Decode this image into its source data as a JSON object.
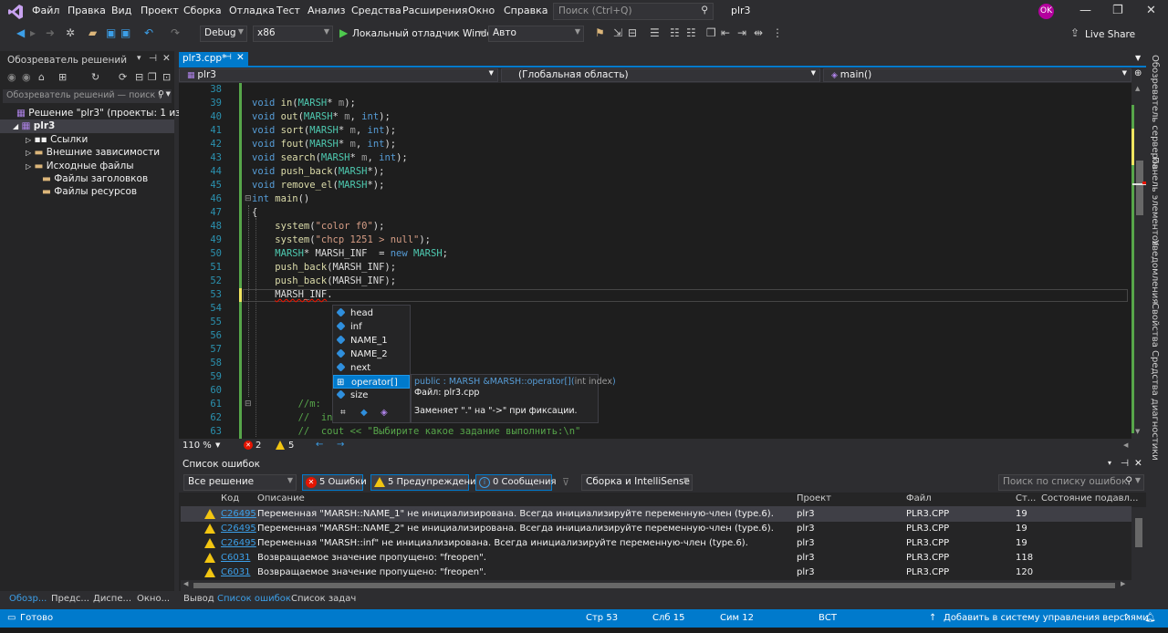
{
  "menu": {
    "items": [
      "Файл",
      "Правка",
      "Вид",
      "Проект",
      "Сборка",
      "Отладка",
      "Тест",
      "Анализ",
      "Средства",
      "Расширения",
      "Окно",
      "Справка"
    ],
    "search_placeholder": "Поиск (Ctrl+Q)",
    "solution_name": "plr3",
    "user_initials": "OK"
  },
  "toolbar": {
    "config": "Debug",
    "platform": "x86",
    "run_label": "Локальный отладчик Windows",
    "run_mode": "Авто",
    "live_share": "Live Share"
  },
  "solution_explorer": {
    "title": "Обозреватель решений",
    "search_placeholder": "Обозреватель решений — поиск (",
    "solution": "Решение \"plr3\" (проекты: 1 из 1)",
    "project": "plr3",
    "items": [
      "Ссылки",
      "Внешние зависимости",
      "Исходные файлы",
      "Файлы заголовков",
      "Файлы ресурсов"
    ],
    "bottom_tabs": [
      "Обозр...",
      "Предс...",
      "Диспе...",
      "Окно..."
    ]
  },
  "editor": {
    "tab_label": "plr3.cpp*",
    "nav_project": "plr3",
    "nav_scope": "(Глобальная область)",
    "nav_member": "main()",
    "zoom": "110 %",
    "errors_count": "2",
    "warnings_count": "5",
    "line_numbers": [
      "38",
      "39",
      "40",
      "41",
      "42",
      "43",
      "44",
      "45",
      "46",
      "47",
      "48",
      "49",
      "50",
      "51",
      "52",
      "53",
      "54",
      "55",
      "56",
      "57",
      "58",
      "59",
      "60",
      "61",
      "62",
      "63"
    ]
  },
  "intellisense": {
    "items": [
      "head",
      "inf",
      "NAME_1",
      "NAME_2",
      "next",
      "operator[]",
      "size"
    ],
    "selected": "operator[]",
    "tooltip_sig_prefix": "public : MARSH &MARSH::operator[](",
    "tooltip_sig_param": "int index",
    "tooltip_sig_suffix": ")",
    "tooltip_file": "Файл: plr3.cpp",
    "tooltip_note": "Заменяет \".\" на \"->\" при фиксации."
  },
  "error_list": {
    "title": "Список ошибок",
    "scope": "Все решение",
    "errors_btn": "5 Ошибки",
    "warnings_btn": "5 Предупреждения",
    "messages_btn": "0 Сообщения",
    "build_filter": "Сборка и IntelliSense",
    "search_placeholder": "Поиск по списку ошибок",
    "columns": [
      "Код",
      "Описание",
      "Проект",
      "Файл",
      "Ст...",
      "Состояние подавл..."
    ],
    "rows": [
      {
        "code": "C26495",
        "desc": "Переменная \"MARSH::NAME_1\" не инициализирована. Всегда инициализируйте переменную-член (type.6).",
        "project": "plr3",
        "file": "PLR3.CPP",
        "line": "19"
      },
      {
        "code": "C26495",
        "desc": "Переменная \"MARSH::NAME_2\" не инициализирована. Всегда инициализируйте переменную-член (type.6).",
        "project": "plr3",
        "file": "PLR3.CPP",
        "line": "19"
      },
      {
        "code": "C26495",
        "desc": "Переменная \"MARSH::inf\" не инициализирована. Всегда инициализируйте переменную-член (type.6).",
        "project": "plr3",
        "file": "PLR3.CPP",
        "line": "19"
      },
      {
        "code": "C6031",
        "desc": "Возвращаемое значение пропущено: \"freopen\".",
        "project": "plr3",
        "file": "PLR3.CPP",
        "line": "118"
      },
      {
        "code": "C6031",
        "desc": "Возвращаемое значение пропущено: \"freopen\".",
        "project": "plr3",
        "file": "PLR3.CPP",
        "line": "120"
      }
    ]
  },
  "output_tabs": [
    "Вывод",
    "Список ошибок",
    "Список задач"
  ],
  "right_sidebar": [
    "Обозреватель серверов",
    "Панель элементов",
    "Уведомления",
    "Свойства",
    "Средства диагностики"
  ],
  "status": {
    "ready": "Готово",
    "line": "Стр 53",
    "col": "Слб 15",
    "char": "Сим 12",
    "mode": "ВСТ",
    "source_control": "Добавить в систему управления версиями"
  },
  "colors": {
    "accent": "#007acc",
    "background": "#2d2d30",
    "editor": "#1e1e1e",
    "warning": "#f2c511",
    "error": "#e51400"
  }
}
